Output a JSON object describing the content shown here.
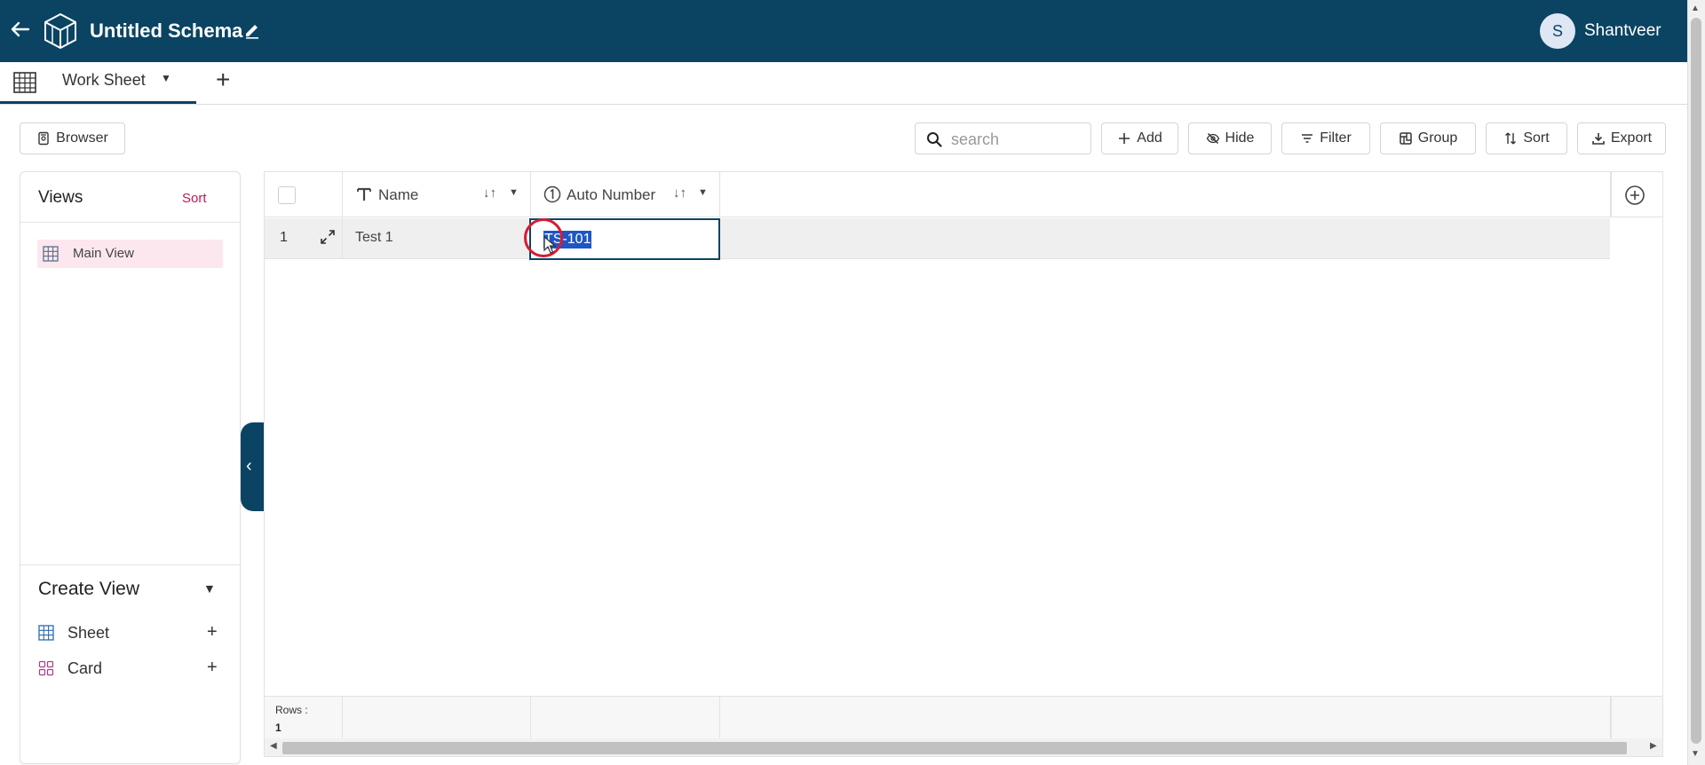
{
  "header": {
    "title": "Untitled Schema",
    "user_initial": "S",
    "user_name": "Shantveer"
  },
  "tabs": {
    "active_label": "Work Sheet"
  },
  "toolbar": {
    "browser_label": "Browser",
    "search_placeholder": "search",
    "add_label": "Add",
    "hide_label": "Hide",
    "filter_label": "Filter",
    "group_label": "Group",
    "sort_label": "Sort",
    "export_label": "Export"
  },
  "views": {
    "title": "Views",
    "sort_label": "Sort",
    "items": [
      {
        "label": "Main View"
      }
    ]
  },
  "create_view": {
    "title": "Create View",
    "items": [
      {
        "label": "Sheet",
        "add": "+"
      },
      {
        "label": "Card",
        "add": "+"
      }
    ]
  },
  "grid": {
    "columns": [
      {
        "label": "Name",
        "type_icon": "text-type-icon"
      },
      {
        "label": "Auto Number",
        "type_icon": "auto-number-type-icon"
      }
    ],
    "rows": [
      {
        "index": "1",
        "name": "Test 1",
        "auto_number": "TS-101"
      }
    ],
    "footer": {
      "rows_label": "Rows :",
      "rows_count": "1"
    }
  },
  "colors": {
    "brand": "#0a4462",
    "accent": "#c2185b",
    "selection": "#1e56c6"
  }
}
